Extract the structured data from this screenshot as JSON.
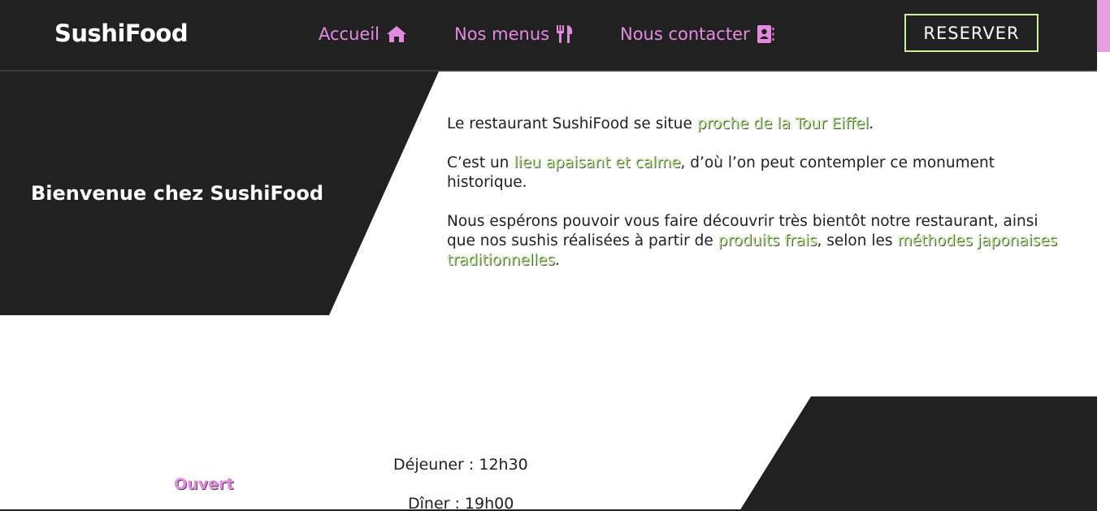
{
  "navbar": {
    "brand": "SushiFood",
    "links": [
      {
        "label": "Accueil",
        "icon": "home-icon"
      },
      {
        "label": "Nos menus",
        "icon": "utensils-icon"
      },
      {
        "label": "Nous contacter",
        "icon": "address-book-icon"
      }
    ],
    "reserve_label": "RESERVER"
  },
  "hero": {
    "title": "Bienvenue chez SushiFood"
  },
  "intro": {
    "p1_before": "Le restaurant SushiFood se situe ",
    "p1_highlight": "proche de la Tour Eiffel",
    "p1_after": ".",
    "p2_before": "C’est un ",
    "p2_highlight": "lieu apaisant et calme",
    "p2_after": ", d’où l’on peut contempler ce monument historique.",
    "p3_before": "Nous espérons pouvoir vous faire découvrir très bientôt notre restaurant, ainsi que nos sushis réalisées à partir de ",
    "p3_highlight1": "produits frais",
    "p3_middle": ", selon les ",
    "p3_highlight2": "méthodes japonaises traditionnelles",
    "p3_after": "."
  },
  "hours": {
    "status": "Ouvert",
    "lunch": "Déjeuner : 12h30",
    "dinner": "Dîner : 19h00"
  },
  "colors": {
    "dark": "#212121",
    "accent_pink": "#e58ae3",
    "accent_green": "#c7f29b",
    "highlight_green": "#b9ec8a"
  }
}
